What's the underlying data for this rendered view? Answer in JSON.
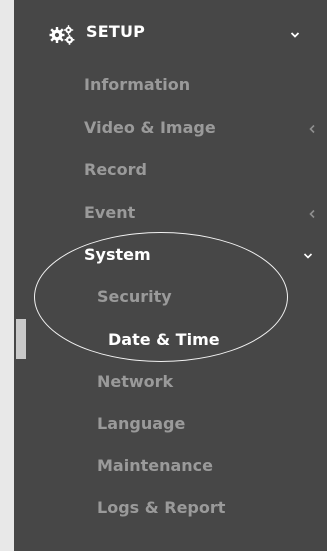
{
  "sidebar": {
    "setup": {
      "label": "SETUP",
      "icon": "gears-icon",
      "expand_icon": "chevron-down-icon"
    },
    "items": [
      {
        "label": "Information",
        "level": 1,
        "has_submenu": false,
        "expanded": false,
        "active": false
      },
      {
        "label": "Video & Image",
        "level": 1,
        "has_submenu": true,
        "expanded": false,
        "active": false
      },
      {
        "label": "Record",
        "level": 1,
        "has_submenu": false,
        "expanded": false,
        "active": false
      },
      {
        "label": "Event",
        "level": 1,
        "has_submenu": true,
        "expanded": false,
        "active": false
      },
      {
        "label": "System",
        "level": 1,
        "has_submenu": true,
        "expanded": true,
        "active": true
      },
      {
        "label": "Security",
        "level": 2,
        "has_submenu": false,
        "expanded": false,
        "active": false
      },
      {
        "label": "Date & Time",
        "level": 3,
        "has_submenu": false,
        "expanded": false,
        "active": false,
        "highlighted": true
      },
      {
        "label": "Network",
        "level": 2,
        "has_submenu": false,
        "expanded": false,
        "active": false
      },
      {
        "label": "Language",
        "level": 2,
        "has_submenu": false,
        "expanded": false,
        "active": false
      },
      {
        "label": "Maintenance",
        "level": 2,
        "has_submenu": false,
        "expanded": false,
        "active": false
      },
      {
        "label": "Logs & Report",
        "level": 2,
        "has_submenu": false,
        "expanded": false,
        "active": false
      }
    ]
  },
  "colors": {
    "sidebar_bg": "#474747",
    "text_primary": "#ffffff",
    "text_muted": "#9a9a9a",
    "annotation_stroke": "#f2f2f2"
  }
}
